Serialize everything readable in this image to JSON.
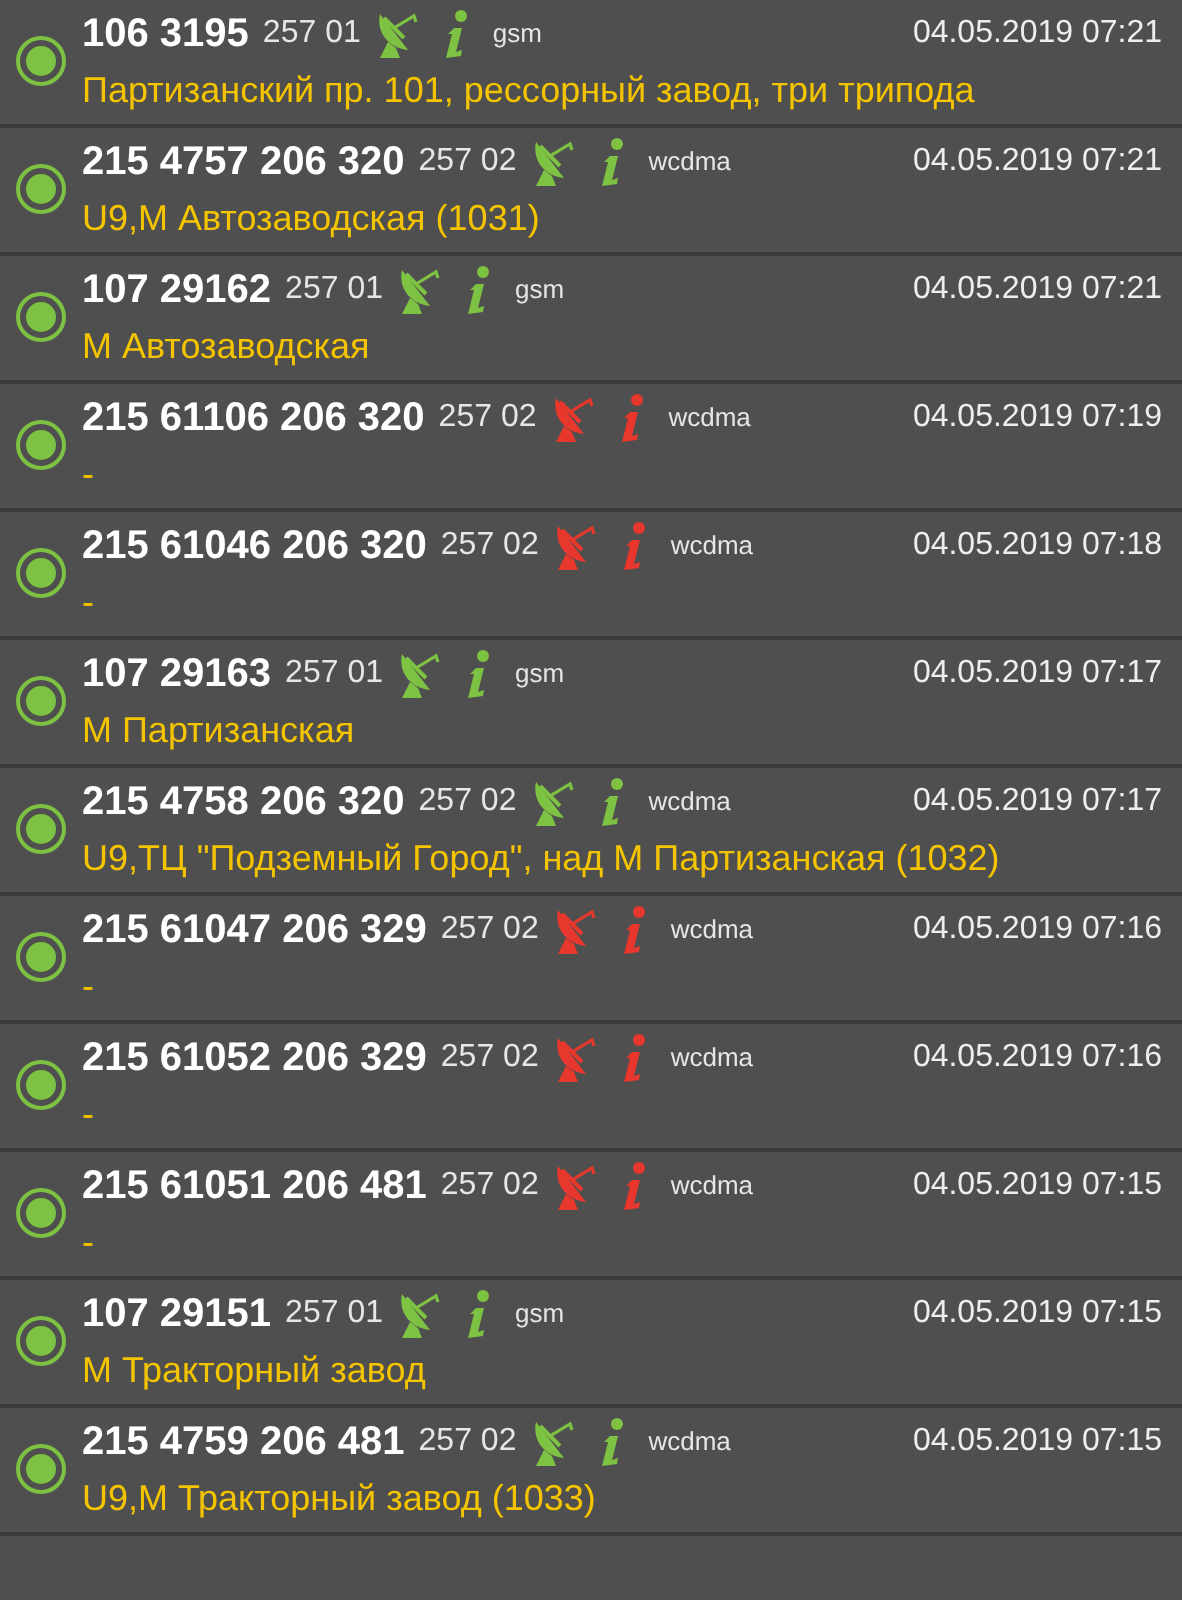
{
  "records": [
    {
      "selected": true,
      "cell_id": "106 3195",
      "network": "257 01",
      "color": "#7dc242",
      "technology": "gsm",
      "time": "04.05.2019 07:21",
      "address": "Партизанский пр. 101, рессорный завод, три трипода"
    },
    {
      "selected": true,
      "cell_id": "215 4757 206 320",
      "network": "257 02",
      "color": "#7dc242",
      "technology": "wcdma",
      "time": "04.05.2019 07:21",
      "address": "U9,М Автозаводская (1031)"
    },
    {
      "selected": true,
      "cell_id": "107 29162",
      "network": "257 01",
      "color": "#7dc242",
      "technology": "gsm",
      "time": "04.05.2019 07:21",
      "address": "М Автозаводская"
    },
    {
      "selected": true,
      "cell_id": "215 61106 206 320",
      "network": "257 02",
      "color": "#e8372c",
      "technology": "wcdma",
      "time": "04.05.2019 07:19",
      "address": "-"
    },
    {
      "selected": true,
      "cell_id": "215 61046 206 320",
      "network": "257 02",
      "color": "#e8372c",
      "technology": "wcdma",
      "time": "04.05.2019 07:18",
      "address": "-"
    },
    {
      "selected": true,
      "cell_id": "107 29163",
      "network": "257 01",
      "color": "#7dc242",
      "technology": "gsm",
      "time": "04.05.2019 07:17",
      "address": "М Партизанская"
    },
    {
      "selected": true,
      "cell_id": "215 4758 206 320",
      "network": "257 02",
      "color": "#7dc242",
      "technology": "wcdma",
      "time": "04.05.2019 07:17",
      "address": "U9,ТЦ \"Подземный Город\", над М Партизанская (1032)"
    },
    {
      "selected": true,
      "cell_id": "215 61047 206 329",
      "network": "257 02",
      "color": "#e8372c",
      "technology": "wcdma",
      "time": "04.05.2019 07:16",
      "address": "-"
    },
    {
      "selected": true,
      "cell_id": "215 61052 206 329",
      "network": "257 02",
      "color": "#e8372c",
      "technology": "wcdma",
      "time": "04.05.2019 07:16",
      "address": "-"
    },
    {
      "selected": true,
      "cell_id": "215 61051 206 481",
      "network": "257 02",
      "color": "#e8372c",
      "technology": "wcdma",
      "time": "04.05.2019 07:15",
      "address": "-"
    },
    {
      "selected": true,
      "cell_id": "107 29151",
      "network": "257 01",
      "color": "#7dc242",
      "technology": "gsm",
      "time": "04.05.2019 07:15",
      "address": "М Тракторный завод"
    },
    {
      "selected": true,
      "cell_id": "215 4759 206 481",
      "network": "257 02",
      "color": "#7dc242",
      "technology": "wcdma",
      "time": "04.05.2019 07:15",
      "address": "U9,М Тракторный завод (1033)"
    }
  ]
}
